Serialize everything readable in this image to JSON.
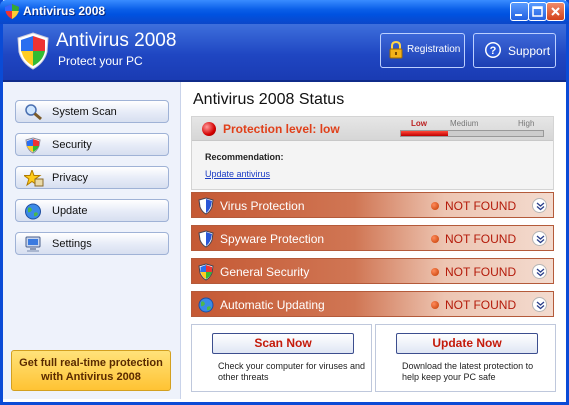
{
  "window": {
    "title": "Antivirus 2008",
    "controls": {
      "minimize_icon": "minimize-icon",
      "maximize_icon": "maximize-icon",
      "close_icon": "close-icon"
    }
  },
  "header": {
    "app_name": "Antivirus 2008",
    "tagline": "Protect your PC",
    "registration_label": "Registration",
    "support_label": "Support",
    "logo_icon": "shield-icon"
  },
  "sidebar": {
    "items": [
      {
        "label": "System Scan",
        "icon": "magnifier-icon"
      },
      {
        "label": "Security",
        "icon": "security-shield-icon"
      },
      {
        "label": "Privacy",
        "icon": "star-icon"
      },
      {
        "label": "Update",
        "icon": "globe-icon"
      },
      {
        "label": "Settings",
        "icon": "computer-icon"
      }
    ],
    "promo": "Get full real-time protection with Antivirus 2008"
  },
  "main": {
    "status_title": "Antivirus 2008 Status",
    "protection": {
      "label": "Protection level: low",
      "meter_labels": {
        "low": "Low",
        "medium": "Medium",
        "high": "High"
      },
      "level_fraction": 0.33,
      "recommendation_label": "Recommendation:",
      "recommendation_link": "Update antivirus"
    },
    "threats": [
      {
        "label": "Virus Protection",
        "status": "NOT FOUND",
        "icon": "shield-icon"
      },
      {
        "label": "Spyware Protection",
        "status": "NOT FOUND",
        "icon": "shield-icon"
      },
      {
        "label": "General Security",
        "status": "NOT FOUND",
        "icon": "security-shield-icon"
      },
      {
        "label": "Automatic Updating",
        "status": "NOT FOUND",
        "icon": "globe-icon"
      }
    ],
    "actions": {
      "scan": {
        "button": "Scan Now",
        "description": "Check your computer for viruses and other threats"
      },
      "update": {
        "button": "Update Now",
        "description": "Download the latest protection to help keep your PC safe"
      }
    }
  },
  "colors": {
    "titlebar": "#0a5ee8",
    "header": "#1f46c2",
    "alert_red": "#e0401a",
    "status_red": "#b41a0a",
    "promo_yellow": "#ffc333"
  }
}
